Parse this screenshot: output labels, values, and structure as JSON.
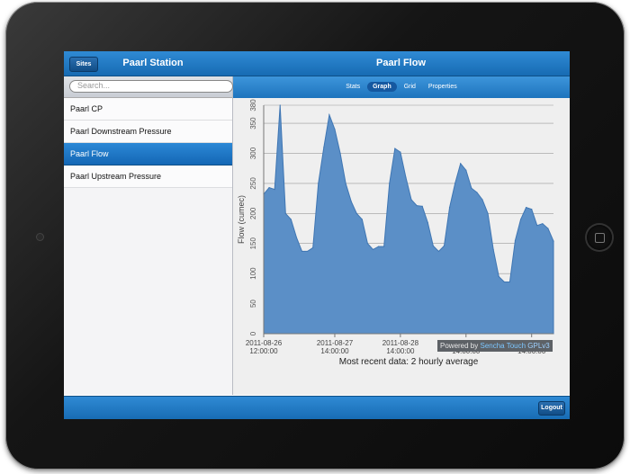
{
  "app": {
    "left_title": "Paarl Station",
    "right_title": "Paarl Flow",
    "back_label": "Sites",
    "logout_label": "Logout"
  },
  "search": {
    "placeholder": "Search..."
  },
  "sidebar": {
    "items": [
      {
        "label": "Paarl CP"
      },
      {
        "label": "Paarl Downstream Pressure"
      },
      {
        "label": "Paarl Flow",
        "selected": true
      },
      {
        "label": "Paarl Upstream Pressure"
      }
    ]
  },
  "tabs": [
    {
      "label": "Stats"
    },
    {
      "label": "Graph",
      "active": true
    },
    {
      "label": "Grid"
    },
    {
      "label": "Properties"
    }
  ],
  "powered": {
    "prefix": "Powered by",
    "brand": "Sencha Touch",
    "license": "GPLv3"
  },
  "chart_data": {
    "type": "area",
    "ylabel": "Flow (cumec)",
    "xlabel": "Most recent data: 2 hourly average",
    "ylim": [
      0,
      380
    ],
    "yticks": [
      0,
      50,
      100,
      150,
      200,
      250,
      300,
      350,
      380
    ],
    "grid": true,
    "color": "#5b8fc7",
    "xticks": [
      {
        "t": 0,
        "date": "2011-08-26",
        "time": "12:00:00"
      },
      {
        "t": 26,
        "date": "2011-08-27",
        "time": "14:00:00"
      },
      {
        "t": 50,
        "date": "2011-08-28",
        "time": "14:00:00"
      },
      {
        "t": 74,
        "date": "2011-08-29",
        "time": "14:00:00"
      },
      {
        "t": 98,
        "date": "2011-08-30",
        "time": "14:00:00"
      }
    ],
    "t_range": [
      0,
      106
    ],
    "points": [
      [
        0,
        232
      ],
      [
        2,
        243
      ],
      [
        4,
        240
      ],
      [
        6,
        380
      ],
      [
        8,
        200
      ],
      [
        10,
        190
      ],
      [
        12,
        160
      ],
      [
        14,
        137
      ],
      [
        16,
        137
      ],
      [
        18,
        143
      ],
      [
        20,
        250
      ],
      [
        22,
        310
      ],
      [
        24,
        364
      ],
      [
        26,
        340
      ],
      [
        28,
        300
      ],
      [
        30,
        250
      ],
      [
        32,
        220
      ],
      [
        34,
        200
      ],
      [
        36,
        190
      ],
      [
        38,
        150
      ],
      [
        40,
        140
      ],
      [
        42,
        145
      ],
      [
        44,
        145
      ],
      [
        46,
        250
      ],
      [
        48,
        308
      ],
      [
        50,
        302
      ],
      [
        52,
        260
      ],
      [
        54,
        223
      ],
      [
        56,
        213
      ],
      [
        58,
        212
      ],
      [
        60,
        185
      ],
      [
        62,
        146
      ],
      [
        64,
        137
      ],
      [
        66,
        146
      ],
      [
        68,
        210
      ],
      [
        70,
        250
      ],
      [
        72,
        283
      ],
      [
        74,
        272
      ],
      [
        76,
        242
      ],
      [
        78,
        235
      ],
      [
        80,
        223
      ],
      [
        82,
        200
      ],
      [
        84,
        140
      ],
      [
        86,
        95
      ],
      [
        88,
        86
      ],
      [
        90,
        86
      ],
      [
        92,
        155
      ],
      [
        94,
        190
      ],
      [
        96,
        210
      ],
      [
        98,
        207
      ],
      [
        100,
        180
      ],
      [
        102,
        183
      ],
      [
        104,
        175
      ],
      [
        106,
        154
      ]
    ]
  }
}
